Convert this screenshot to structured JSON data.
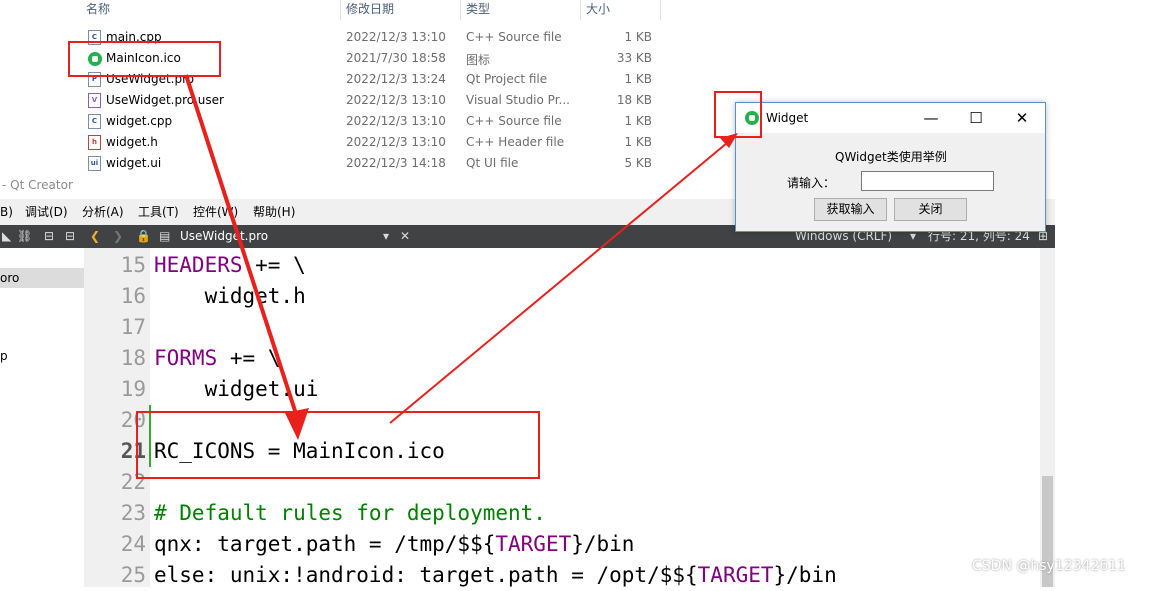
{
  "explorer": {
    "columns": {
      "name": "名称",
      "date": "修改日期",
      "type": "类型",
      "size": "大小"
    },
    "files": [
      {
        "name": "main.cpp",
        "date": "2022/12/3 13:10",
        "type": "C++ Source file",
        "size": "1 KB",
        "icon": "cpp-file-icon"
      },
      {
        "name": "MainIcon.ico",
        "date": "2021/7/30 18:58",
        "type": "图标",
        "size": "33 KB",
        "icon": "ico-file-icon"
      },
      {
        "name": "UseWidget.pro",
        "date": "2022/12/3 13:24",
        "type": "Qt Project file",
        "size": "1 KB",
        "icon": "pro-file-icon"
      },
      {
        "name": "UseWidget.pro.user",
        "date": "2022/12/3 13:10",
        "type": "Visual Studio Pr...",
        "size": "18 KB",
        "icon": "user-file-icon"
      },
      {
        "name": "widget.cpp",
        "date": "2022/12/3 13:10",
        "type": "C++ Source file",
        "size": "1 KB",
        "icon": "cpp-file-icon"
      },
      {
        "name": "widget.h",
        "date": "2022/12/3 13:10",
        "type": "C++ Header file",
        "size": "1 KB",
        "icon": "header-file-icon"
      },
      {
        "name": "widget.ui",
        "date": "2022/12/3 14:18",
        "type": "Qt UI file",
        "size": "5 KB",
        "icon": "ui-file-icon"
      }
    ]
  },
  "qt": {
    "title": "- Qt Creator",
    "menu": [
      "B)",
      "调试(D)",
      "分析(A)",
      "工具(T)",
      "控件(W)",
      "帮助(H)"
    ],
    "toolbar": {
      "file": "UseWidget.pro",
      "line_ending": "Windows (CRLF)",
      "position": "行号: 21, 列号: 24"
    },
    "sidebar": {
      "selected": "oro",
      "item2": "p"
    },
    "lines": [
      {
        "num": "15",
        "text": "HEADERS += \\"
      },
      {
        "num": "16",
        "text": "    widget.h"
      },
      {
        "num": "17",
        "text": ""
      },
      {
        "num": "18",
        "text": "FORMS += \\"
      },
      {
        "num": "19",
        "text": "    widget.ui"
      },
      {
        "num": "20",
        "text": ""
      },
      {
        "num": "21",
        "text": "RC_ICONS = MainIcon.ico"
      },
      {
        "num": "22",
        "text": ""
      },
      {
        "num": "23",
        "text": "# Default rules for deployment."
      },
      {
        "num": "24",
        "text": "qnx: target.path = /tmp/$${TARGET}/bin"
      },
      {
        "num": "25",
        "text": "else: unix:!android: target.path = /opt/$${TARGET}/bin"
      }
    ]
  },
  "widget": {
    "title": "Widget",
    "heading": "QWidget类使用举例",
    "input_label": "请输入：",
    "input_value": "",
    "get_button": "获取输入",
    "close_button": "关闭"
  },
  "watermark": "CSDN @hsy12342611",
  "colors": {
    "annotation_red": "#e8211d",
    "keyword_purple": "#800080",
    "comment_green": "#008000"
  }
}
